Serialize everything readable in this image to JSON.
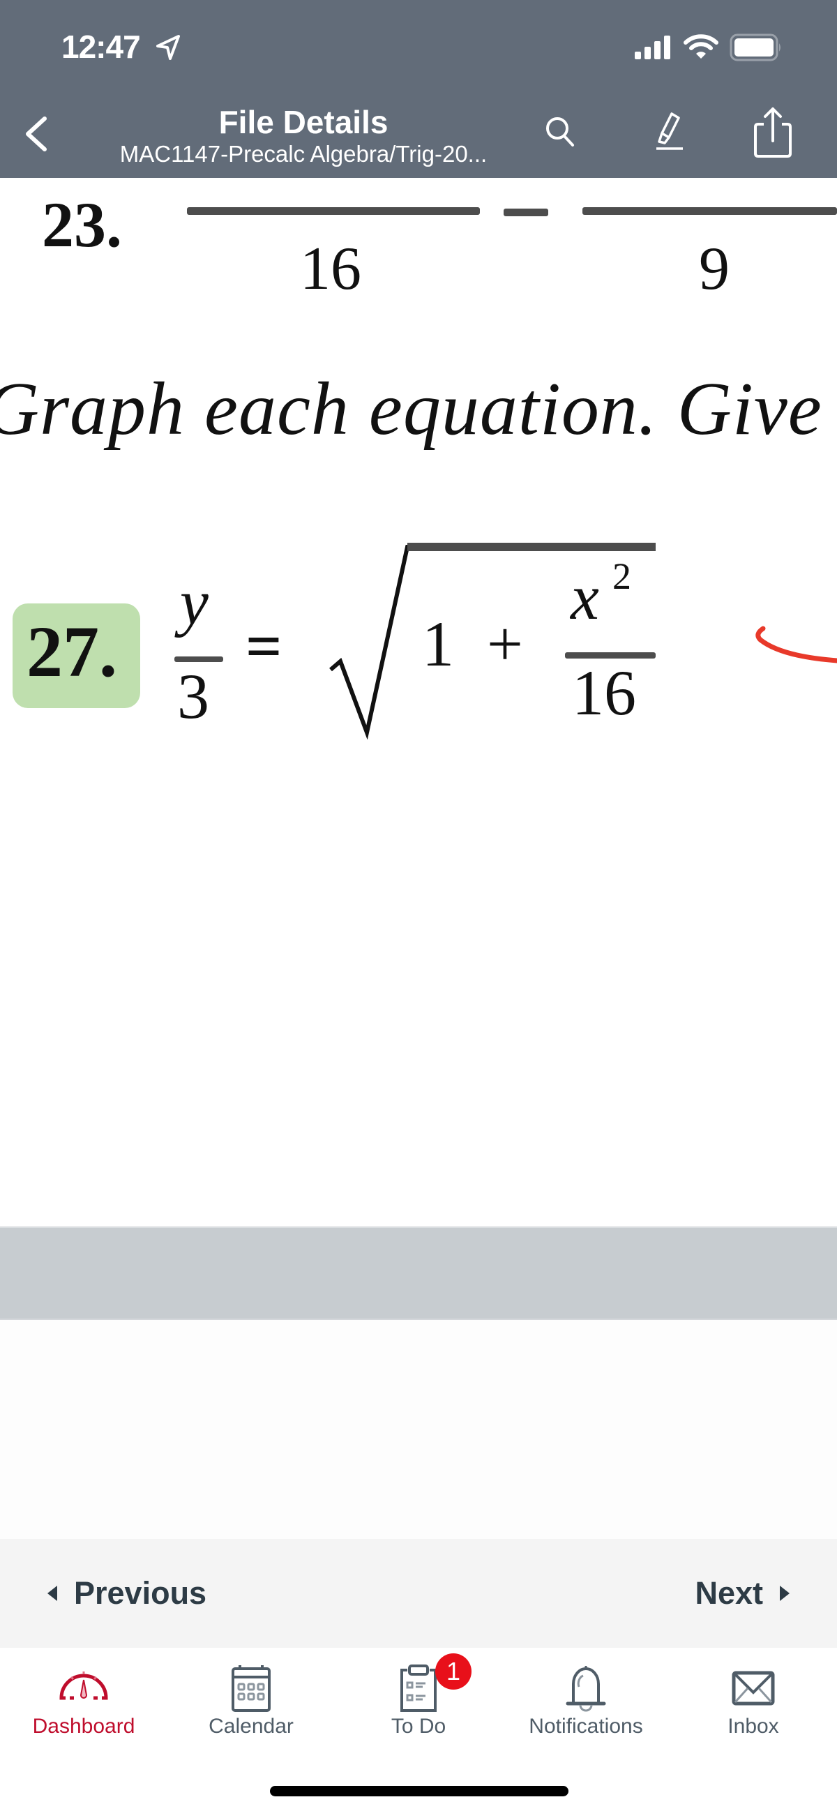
{
  "status_bar": {
    "time": "12:47",
    "icons": [
      "location-arrow-icon",
      "cellular-signal-icon",
      "wifi-icon",
      "battery-icon"
    ]
  },
  "header": {
    "title": "File Details",
    "subtitle": "MAC1147-Precalc Algebra/Trig-20...",
    "buttons": [
      "back-icon",
      "search-icon",
      "highlighter-icon",
      "share-icon"
    ],
    "background_color": "#626c79"
  },
  "document": {
    "problem_23": {
      "number": "23.",
      "denominators": [
        "16",
        "9"
      ],
      "operator": "−"
    },
    "instruction": "Graph each equation. Give",
    "problem_27": {
      "number": "27.",
      "lhs_numerator": "y",
      "lhs_denominator": "3",
      "equals": "=",
      "radical_term": "1",
      "plus": "+",
      "rhs_numerator": "x",
      "rhs_exponent": "2",
      "rhs_denominator": "16",
      "highlight_color": "#bfdfae"
    },
    "annotation_color": "#e8392a"
  },
  "pager": {
    "previous_label": "Previous",
    "next_label": "Next"
  },
  "tabbar": {
    "active_color": "#bf0d2c",
    "items": [
      {
        "label": "Dashboard",
        "icon": "dashboard-gauge-icon",
        "active": true
      },
      {
        "label": "Calendar",
        "icon": "calendar-icon",
        "active": false
      },
      {
        "label": "To Do",
        "icon": "clipboard-todo-icon",
        "active": false,
        "badge": "1"
      },
      {
        "label": "Notifications",
        "icon": "bell-icon",
        "active": false
      },
      {
        "label": "Inbox",
        "icon": "envelope-icon",
        "active": false
      }
    ]
  }
}
